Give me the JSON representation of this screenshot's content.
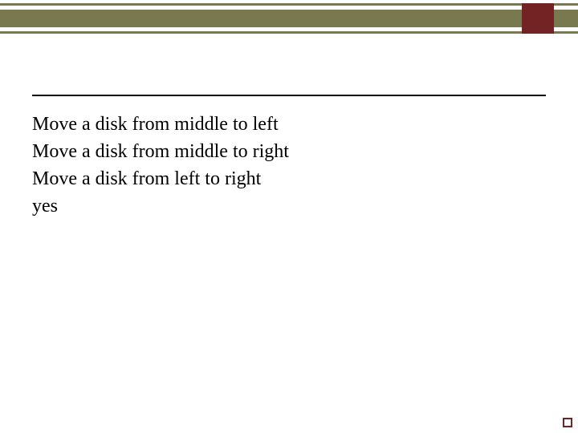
{
  "colors": {
    "band": "#797950",
    "accent": "#732323",
    "rule": "#000000"
  },
  "lines": {
    "l1": "Move a disk from middle to left",
    "l2": "Move a disk from middle to right",
    "l3": "Move a disk from left to right",
    "l4": "yes"
  }
}
